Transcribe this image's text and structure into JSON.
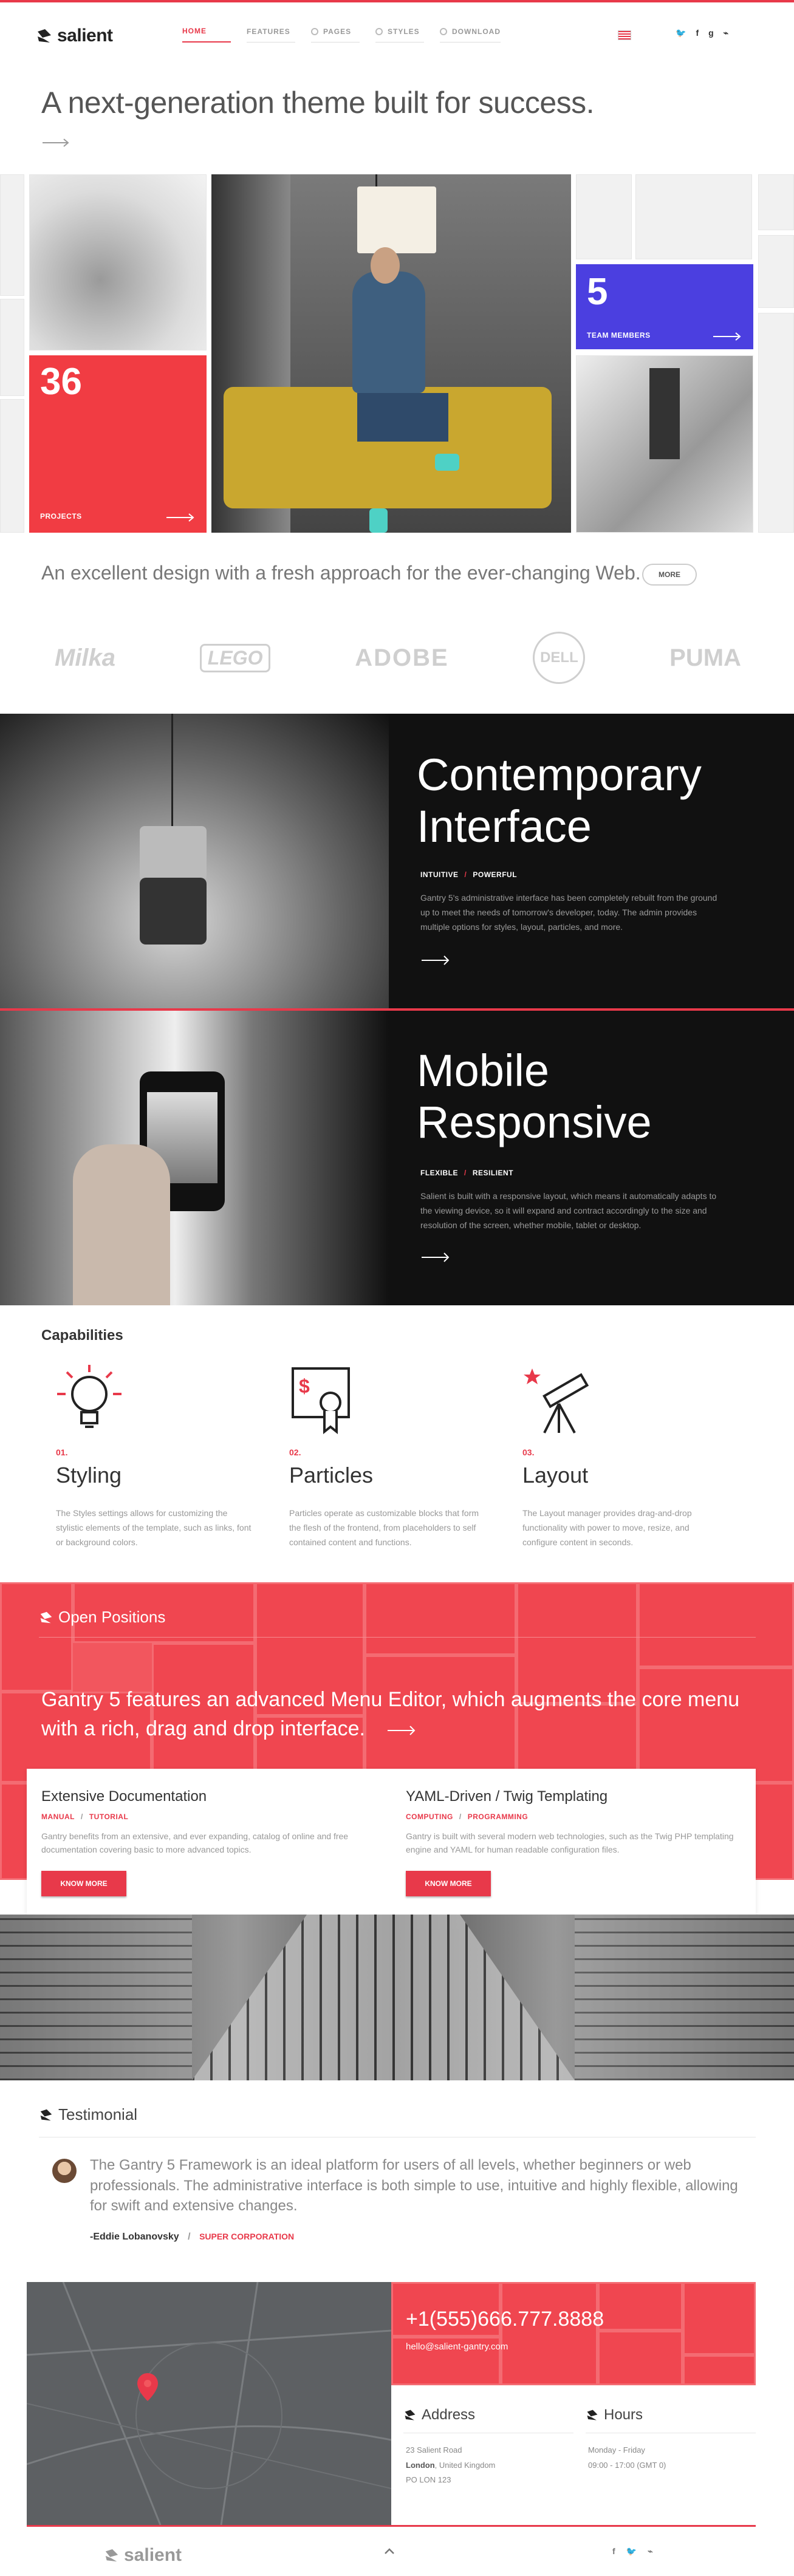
{
  "header": {
    "logo": "salient",
    "nav": [
      {
        "label": "HOME",
        "active": true
      },
      {
        "label": "FEATURES",
        "active": false
      },
      {
        "label": "PAGES",
        "active": false
      },
      {
        "label": "STYLES",
        "active": false
      },
      {
        "label": "DOWNLOAD",
        "active": false
      }
    ],
    "socials": [
      "twitter-icon",
      "facebook-icon",
      "google-plus-icon",
      "rss-icon"
    ],
    "social_glyphs": [
      "🐦",
      "f",
      "g",
      "⌁"
    ]
  },
  "hero": {
    "title": "A next-generation theme built for success."
  },
  "stats": [
    {
      "number": "36",
      "label": "PROJECTS"
    },
    {
      "number": "5",
      "label": "TEAM MEMBERS"
    }
  ],
  "tagline": {
    "text": "An excellent design with a fresh approach for the ever-changing Web.",
    "button": "MORE"
  },
  "brands": [
    "Milka",
    "LEGO",
    "ADOBE",
    "DELL",
    "PUMA"
  ],
  "features": [
    {
      "title_line1": "Contemporary",
      "title_line2": "Interface",
      "tag1": "INTUITIVE",
      "tag2": "POWERFUL",
      "body": "Gantry 5's administrative interface has been completely rebuilt from the ground up to meet the needs of tomorrow's developer, today. The admin provides multiple options for styles, layout, particles, and more."
    },
    {
      "title_line1": "Mobile",
      "title_line2": "Responsive",
      "tag1": "FLEXIBLE",
      "tag2": "RESILIENT",
      "body": "Salient is built with a responsive layout, which means it automatically adapts to the viewing device, so it will expand and contract accordingly to the size and resolution of the screen, whether mobile, tablet or desktop."
    }
  ],
  "capabilities": {
    "title": "Capabilities",
    "items": [
      {
        "num": "01.",
        "title": "Styling",
        "icon": "lightbulb-icon",
        "body": "The Styles settings allows for customizing the stylistic elements of the template, such as links, font or background colors."
      },
      {
        "num": "02.",
        "title": "Particles",
        "icon": "certificate-icon",
        "body": "Particles operate as customizable blocks that form the flesh of the frontend, from placeholders to self contained content and functions."
      },
      {
        "num": "03.",
        "title": "Layout",
        "icon": "telescope-icon",
        "body": "The Layout manager provides drag-and-drop functionality with power to move, resize, and configure content in seconds."
      }
    ]
  },
  "positions": {
    "title": "Open Positions",
    "headline": "Gantry 5 features an advanced Menu Editor, which augments the core menu with a rich, drag and drop interface.",
    "cards": [
      {
        "title": "Extensive Documentation",
        "tag1": "MANUAL",
        "tag2": "TUTORIAL",
        "body": "Gantry benefits from an extensive, and ever expanding, catalog of online and free documentation covering basic to more advanced topics.",
        "button": "KNOW MORE"
      },
      {
        "title": "YAML-Driven / Twig Templating",
        "tag1": "COMPUTING",
        "tag2": "PROGRAMMING",
        "body": "Gantry is built with several modern web technologies, such as the Twig PHP templating engine and YAML for human readable configuration files.",
        "button": "KNOW MORE"
      }
    ]
  },
  "testimonial": {
    "title": "Testimonial",
    "quote": "The Gantry 5 Framework is an ideal platform for users of all levels, whether beginners or web professionals. The administrative interface is both simple to use, intuitive and highly flexible, allowing for swift and extensive changes.",
    "author": "-Eddie Lobanovsky",
    "company": "SUPER CORPORATION"
  },
  "contact": {
    "phone": "+1(555)666.777.8888",
    "email": "hello@salient-gantry.com",
    "address_title": "Address",
    "address_line1": "23 Salient Road",
    "address_city": "London",
    "address_country": ", United Kingdom",
    "address_line3": "PO LON 123",
    "hours_title": "Hours",
    "hours_days": "Monday - Friday",
    "hours_time": "09:00 - 17:00 (GMT 0)"
  },
  "footer": {
    "logo": "salient",
    "social_glyphs": [
      "f",
      "🐦",
      "⌁"
    ]
  },
  "colors": {
    "accent": "#e8394a",
    "blue": "#4b3fe0"
  }
}
